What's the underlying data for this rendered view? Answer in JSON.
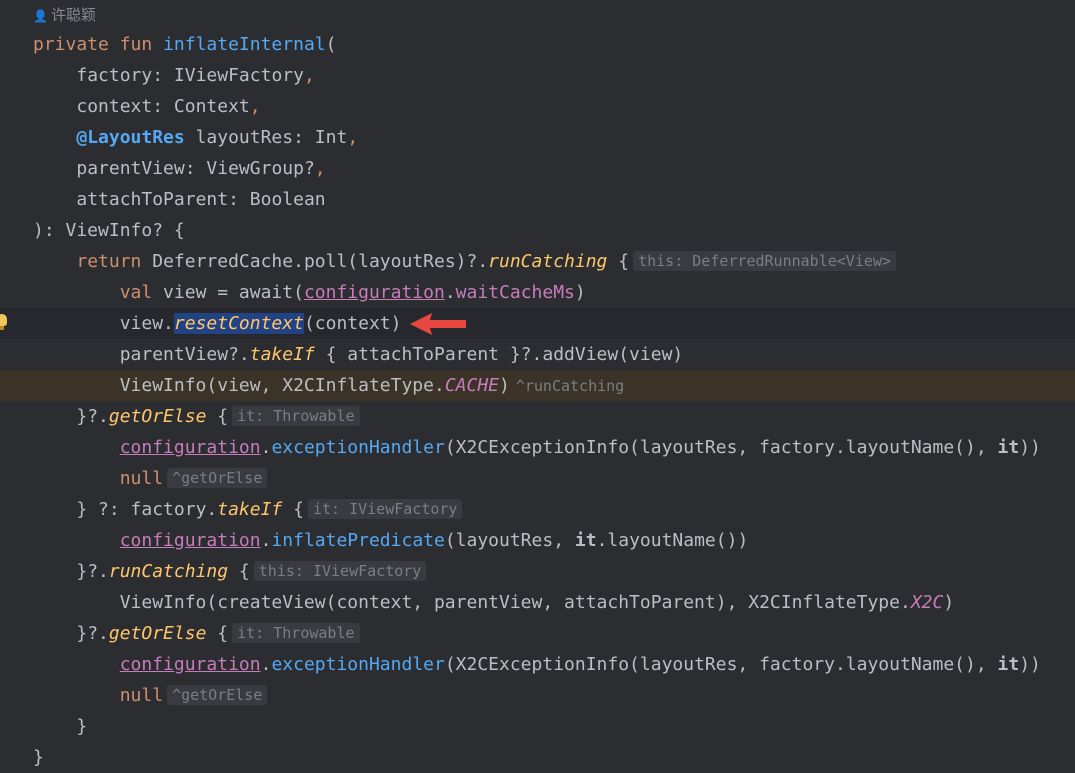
{
  "author": "许聪颖",
  "lines": {
    "l1": {
      "kw1": "private",
      "kw2": "fun",
      "fn": "inflateInternal",
      "rest": "("
    },
    "l2": {
      "name": "factory",
      "sep": ": ",
      "type": "IViewFactory",
      "comma": ","
    },
    "l3": {
      "name": "context",
      "sep": ": ",
      "type": "Context",
      "comma": ","
    },
    "l4": {
      "ann": "@LayoutRes",
      "name": " layoutRes",
      "sep": ": ",
      "type": "Int",
      "comma": ","
    },
    "l5": {
      "name": "parentView",
      "sep": ": ",
      "type": "ViewGroup?",
      "comma": ","
    },
    "l6": {
      "name": "attachToParent",
      "sep": ": ",
      "type": "Boolean"
    },
    "l7": {
      "text": "): ViewInfo? {"
    },
    "l8": {
      "kw": "return",
      "a": " DeferredCache.poll(layoutRes)?.",
      "fn": "runCatching",
      "b": " {",
      "hint": "this: DeferredRunnable<View>"
    },
    "l9": {
      "kw": "val",
      "a": " view = await(",
      "link": "configuration",
      "b": ".",
      "prop": "waitCacheMs",
      "c": ")"
    },
    "l10": {
      "a": "view.",
      "sel": "resetContext",
      "b": "(context)"
    },
    "l11": {
      "a": "parentView?.",
      "fn": "takeIf",
      "b": " { attachToParent }?.addView(view)"
    },
    "l12": {
      "a": "ViewInfo(view, X2CInflateType.",
      "enum": "CACHE",
      "b": ")",
      "hint": "^runCatching"
    },
    "l13": {
      "a": "}?.",
      "fn": "getOrElse",
      "b": " {",
      "hint": "it: Throwable"
    },
    "l14": {
      "link": "configuration",
      "a": ".",
      "prop": "exceptionHandler",
      "b": "(X2CExceptionInfo(layoutRes, factory.layoutName(), ",
      "it": "it",
      "c": "))"
    },
    "l15": {
      "kw": "null",
      "hint": "^getOrElse"
    },
    "l16": {
      "a": "} ?: factory.",
      "fn": "takeIf",
      "b": " {",
      "hint": "it: IViewFactory"
    },
    "l17": {
      "link": "configuration",
      "a": ".",
      "prop": "inflatePredicate",
      "b": "(layoutRes, ",
      "it": "it",
      "c": ".layoutName())"
    },
    "l18": {
      "a": "}?.",
      "fn": "runCatching",
      "b": " {",
      "hint": "this: IViewFactory"
    },
    "l19": {
      "a": "ViewInfo(createView(context, parentView, attachToParent), X2CInflateType.",
      "enum": "X2C",
      "b": ")"
    },
    "l20": {
      "a": "}?.",
      "fn": "getOrElse",
      "b": " {",
      "hint": "it: Throwable"
    },
    "l21": {
      "link": "configuration",
      "a": ".",
      "prop": "exceptionHandler",
      "b": "(X2CExceptionInfo(layoutRes, factory.layoutName(), ",
      "it": "it",
      "c": "))"
    },
    "l22": {
      "kw": "null",
      "hint": "^getOrElse"
    },
    "l23": {
      "text": "}"
    },
    "l24": {
      "text": "}"
    }
  },
  "icons": {
    "bulb": "lightbulb-icon",
    "arrow": "red-arrow-annotation",
    "author": "person-icon"
  },
  "colors": {
    "background": "#2b2d30",
    "keyword": "#cf8e6d",
    "function": "#56a8f5",
    "selection": "#214283",
    "arrow": "#e8473f"
  }
}
